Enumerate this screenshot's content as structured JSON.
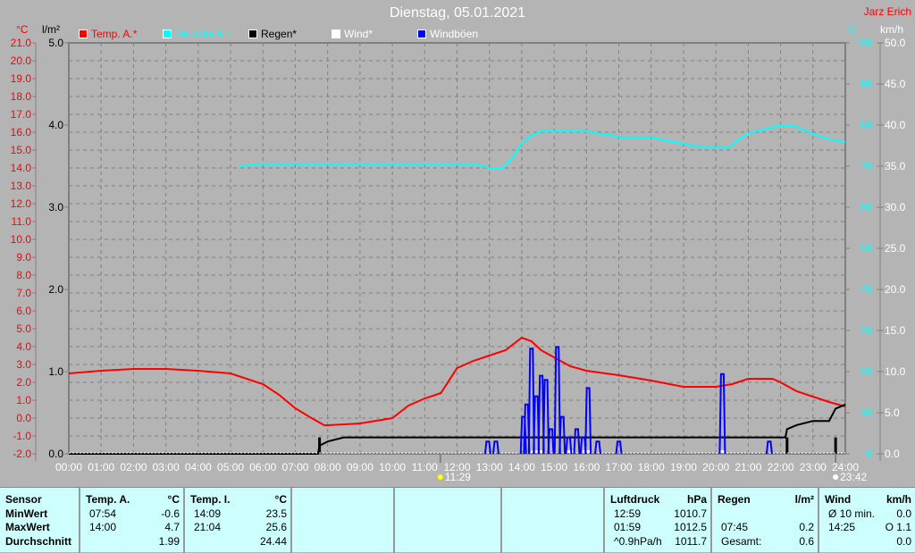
{
  "title": "Dienstag, 05.01.2021",
  "author": "Jarz Erich",
  "legend": [
    {
      "label": "Temp. A.*",
      "color": "#ff0000"
    },
    {
      "label": "Feuchte A.*",
      "color": "#00ffff"
    },
    {
      "label": "Regen*",
      "color": "#000000"
    },
    {
      "label": "Wind*",
      "color": "#ffffff"
    },
    {
      "label": "Windböen",
      "color": "#0000ff"
    }
  ],
  "chart_data": {
    "type": "line",
    "title": "Dienstag, 05.01.2021",
    "x_ticks": [
      "00:00",
      "01:00",
      "02:00",
      "03:00",
      "04:00",
      "05:00",
      "06:00",
      "07:00",
      "08:00",
      "09:00",
      "10:00",
      "11:00",
      "12:00",
      "13:00",
      "14:00",
      "15:00",
      "16:00",
      "17:00",
      "18:00",
      "19:00",
      "20:00",
      "21:00",
      "22:00",
      "23:00",
      "24:00"
    ],
    "axes": {
      "temp": {
        "unit": "°C",
        "range": [
          -2.0,
          21.0
        ],
        "color": "#ff0000"
      },
      "rain": {
        "unit": "l/m²",
        "range": [
          0,
          5.0
        ],
        "ticks": [
          "5.0",
          "4.0",
          "3.0",
          "2.0",
          "1.0",
          "0.0"
        ],
        "color": "#000000"
      },
      "humidity": {
        "unit": "%",
        "range": [
          0,
          100
        ],
        "color": "#00ffff"
      },
      "wind": {
        "unit": "km/h",
        "range": [
          0,
          50.0
        ],
        "color": "#ffffff"
      }
    },
    "grid": true,
    "legend_position": "top",
    "series": [
      {
        "name": "Temp. A.*",
        "axis": "temp",
        "color": "#ff0000",
        "x": [
          0,
          1,
          2,
          3,
          4,
          5,
          6,
          6.5,
          7,
          7.5,
          7.9,
          8,
          9,
          10,
          10.5,
          11,
          11.5,
          12,
          12.5,
          13,
          13.5,
          14,
          14.3,
          14.6,
          15,
          15.5,
          16,
          17,
          18,
          19,
          20,
          20.5,
          21,
          21.75,
          22,
          22.5,
          23,
          23.5,
          24
        ],
        "y": [
          2.5,
          2.65,
          2.75,
          2.75,
          2.65,
          2.5,
          1.9,
          1.3,
          0.55,
          0,
          -0.4,
          -0.4,
          -0.3,
          0,
          0.7,
          1.1,
          1.4,
          2.8,
          3.2,
          3.5,
          3.8,
          4.5,
          4.3,
          3.8,
          3.4,
          2.9,
          2.65,
          2.4,
          2.1,
          1.75,
          1.75,
          1.9,
          2.2,
          2.2,
          2.0,
          1.5,
          1.2,
          0.9,
          0.65
        ]
      },
      {
        "name": "Feuchte A.*",
        "axis": "humidity",
        "color": "#00ffff",
        "x": [
          5.25,
          6,
          7,
          8,
          9,
          10,
          11,
          12,
          12.6,
          13,
          13.4,
          13.7,
          14,
          14.3,
          14.6,
          15,
          16,
          16.3,
          16.8,
          17,
          18,
          19,
          19.5,
          20,
          20.4,
          20.7,
          21,
          21.5,
          22,
          22.4,
          22.8,
          23.3,
          24
        ],
        "y": [
          70,
          70.5,
          70.5,
          70.5,
          70.5,
          70.5,
          70.5,
          70.5,
          70.5,
          69.5,
          69.5,
          72,
          75.5,
          77.5,
          78.5,
          78.5,
          78.5,
          78,
          77.5,
          77,
          77,
          75.5,
          74.8,
          74.5,
          74.5,
          76.5,
          78,
          79,
          80,
          80,
          78.5,
          77,
          75.8
        ]
      },
      {
        "name": "Regen*",
        "axis": "rain",
        "color": "#000000",
        "type": "cumulative",
        "x": [
          0,
          7.7,
          7.75,
          8,
          8.5,
          22.15,
          22.2,
          22.5,
          23,
          23.5,
          23.7,
          24
        ],
        "y": [
          0,
          0,
          0.1,
          0.15,
          0.2,
          0.2,
          0.3,
          0.35,
          0.4,
          0.4,
          0.55,
          0.6
        ]
      },
      {
        "name": "Regen bars",
        "axis": "rain",
        "color": "#000000",
        "type": "bar",
        "x": [
          7.75,
          22.2,
          23.7
        ],
        "y": [
          0.2,
          0.2,
          0.2
        ]
      },
      {
        "name": "Wind*",
        "axis": "wind",
        "color": "#ffffff",
        "x": [
          14.4,
          14.6,
          15.5,
          16.0,
          20.2
        ],
        "y": [
          0.3,
          0.3,
          0.2,
          0.2,
          0.2
        ]
      },
      {
        "name": "Windböen",
        "axis": "wind",
        "color": "#0000ff",
        "type": "spikes",
        "x": [
          12.95,
          13.2,
          14.05,
          14.15,
          14.3,
          14.45,
          14.6,
          14.75,
          14.9,
          15.1,
          15.25,
          15.45,
          15.7,
          15.9,
          16.05,
          16.35,
          17.0,
          20.2,
          21.65
        ],
        "y": [
          1.5,
          1.5,
          4.5,
          6,
          12.8,
          7,
          9.5,
          9,
          3,
          13,
          4.5,
          2,
          3,
          2,
          8,
          1.5,
          1.5,
          9.7,
          1.5
        ]
      }
    ],
    "markers": [
      {
        "label": "11:29",
        "icon": "sunrise-icon"
      },
      {
        "label": "23:42",
        "icon": "moonrise-icon"
      }
    ]
  },
  "table": {
    "sensor": {
      "header": "Sensor",
      "rows": [
        "MinWert",
        "MaxWert",
        "Durchschnitt"
      ]
    },
    "temp_a": {
      "header": "Temp. A.",
      "unit": "°C",
      "rows": [
        [
          "07:54",
          "-0.6"
        ],
        [
          "14:00",
          "4.7"
        ],
        [
          "",
          "1.99"
        ]
      ]
    },
    "temp_i": {
      "header": "Temp. I.",
      "unit": "°C",
      "rows": [
        [
          "14:09",
          "23.5"
        ],
        [
          "21:04",
          "25.6"
        ],
        [
          "",
          "24.44"
        ]
      ]
    },
    "pressure": {
      "header": "Luftdruck",
      "unit": "hPa",
      "rows": [
        [
          "12:59",
          "1010.7"
        ],
        [
          "01:59",
          "1012.5"
        ],
        [
          "^0.9hPa/h",
          "1011.7"
        ]
      ]
    },
    "rain": {
      "header": "Regen",
      "unit": "l/m²",
      "rows": [
        [
          "",
          ""
        ],
        [
          "07:45",
          "0.2"
        ],
        [
          "Gesamt:",
          "0.6"
        ]
      ]
    },
    "wind": {
      "header": "Wind",
      "unit": "km/h",
      "rows": [
        [
          "Ø 10 min.",
          "0.0"
        ],
        [
          "14:25",
          "O 1.1"
        ],
        [
          "",
          "0.0"
        ]
      ]
    }
  }
}
